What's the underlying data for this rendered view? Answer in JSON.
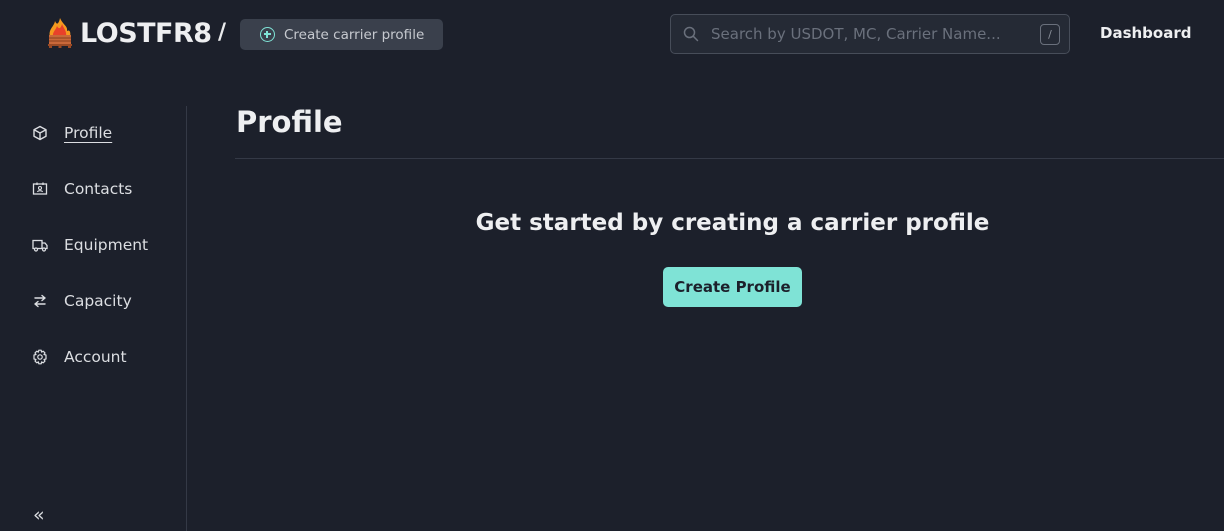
{
  "header": {
    "brand": "LOSTFR8",
    "separator": "/",
    "breadcrumb_button": "Create carrier profile",
    "search_placeholder": "Search by USDOT, MC, Carrier Name...",
    "search_value": "",
    "search_shortcut": "/",
    "dashboard_link": "Dashboard"
  },
  "sidebar": {
    "items": [
      {
        "label": "Profile",
        "icon": "cube-icon",
        "active": true
      },
      {
        "label": "Contacts",
        "icon": "contact-card-icon",
        "active": false
      },
      {
        "label": "Equipment",
        "icon": "truck-icon",
        "active": false
      },
      {
        "label": "Capacity",
        "icon": "arrows-swap-icon",
        "active": false
      },
      {
        "label": "Account",
        "icon": "gear-icon",
        "active": false
      }
    ],
    "collapse_glyph": "«"
  },
  "main": {
    "title": "Profile",
    "empty_state_title": "Get started by creating a carrier profile",
    "create_button": "Create Profile"
  },
  "colors": {
    "background": "#1c202b",
    "accent": "#7fe3d6",
    "pill": "#3a404c"
  }
}
